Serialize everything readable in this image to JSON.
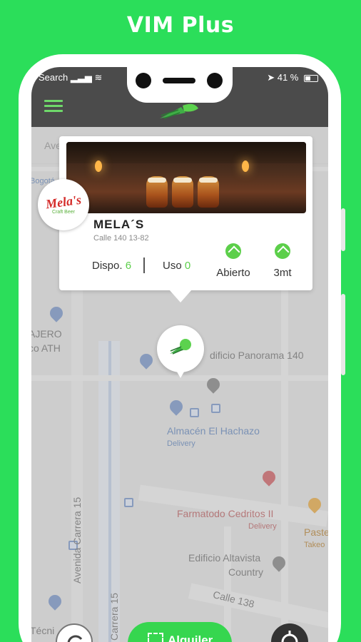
{
  "banner": {
    "title": "VIM Plus"
  },
  "status_bar": {
    "carrier": "Search",
    "battery": "41 %"
  },
  "search": {
    "placeholder": "Ave"
  },
  "card": {
    "name": "MELA´S",
    "address": "Calle 140 13-82",
    "logo_text": "Mela's",
    "logo_sub": "Craft Beer",
    "available_label": "Dispo.",
    "available_count": "6",
    "in_use_label": "Uso",
    "in_use_count": "0",
    "open_label": "Abierto",
    "distance_label": "3mt"
  },
  "map_labels": {
    "bogota": "Bogotá",
    "cajero_1": "AJERO",
    "cajero_2": "co ATH",
    "edificio_panorama": "dificio Panorama 140",
    "almacen": "Almacén El Hachazo",
    "almacen_sub": "Delivery",
    "farmatodo": "Farmatodo Cedritos II",
    "farmatodo_sub": "Delivery",
    "edificio_altavista_1": "Edificio Altavista",
    "edificio_altavista_2": "Country",
    "calle": "Calle 138",
    "avenida": "Avenida Carrera 15",
    "carrera_15": "Carrera 15",
    "paste": "Paste",
    "paste_sub": "Takeo",
    "tecnic": "Técni"
  },
  "actions": {
    "rent_label": "Alquiler"
  },
  "colors": {
    "accent": "#2bde5a",
    "button_green": "#36d64f",
    "icon_green": "#5ccf4a"
  }
}
